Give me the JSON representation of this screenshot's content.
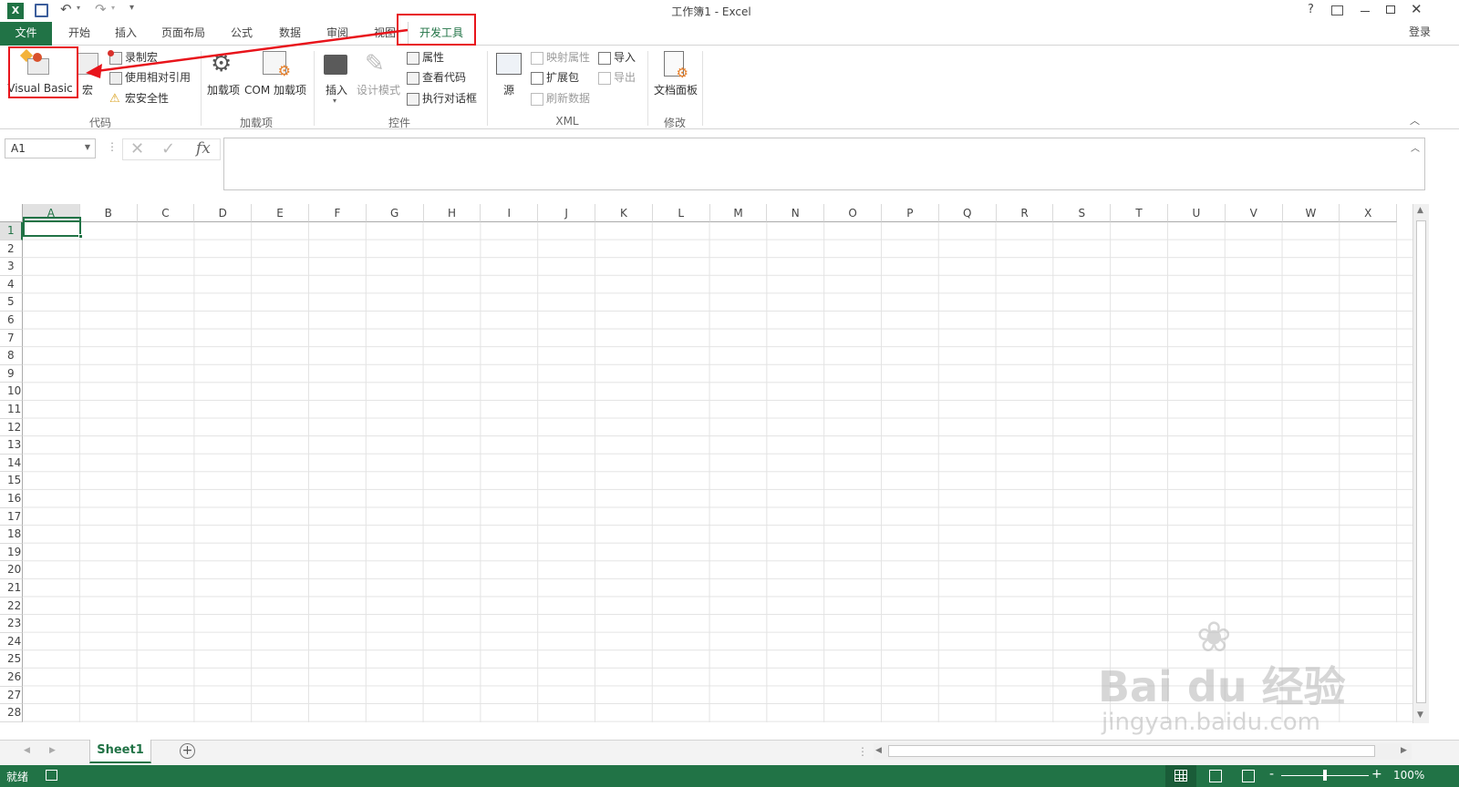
{
  "window": {
    "title": "工作簿1 - Excel",
    "help": "?",
    "signin": "登录"
  },
  "tabs": [
    {
      "label": "文件"
    },
    {
      "label": "开始"
    },
    {
      "label": "插入"
    },
    {
      "label": "页面布局"
    },
    {
      "label": "公式"
    },
    {
      "label": "数据"
    },
    {
      "label": "审阅"
    },
    {
      "label": "视图"
    },
    {
      "label": "开发工具"
    }
  ],
  "ribbon": {
    "code": {
      "label": "代码",
      "visual_basic": "Visual Basic",
      "macro": "宏",
      "record_macro": "录制宏",
      "relative_ref": "使用相对引用",
      "macro_security": "宏安全性"
    },
    "addins": {
      "label": "加载项",
      "addins": "加载项",
      "com_addins": "COM 加载项"
    },
    "controls": {
      "label": "控件",
      "insert": "插入",
      "design_mode": "设计模式",
      "properties": "属性",
      "view_code": "查看代码",
      "run_dialog": "执行对话框"
    },
    "xml": {
      "label": "XML",
      "source": "源",
      "map_props": "映射属性",
      "expansion": "扩展包",
      "refresh": "刷新数据",
      "import": "导入",
      "export": "导出"
    },
    "modify": {
      "label": "修改",
      "doc_panel": "文档面板"
    }
  },
  "formula": {
    "namebox": "A1",
    "fx": "fx",
    "value": ""
  },
  "grid": {
    "columns": [
      "A",
      "B",
      "C",
      "D",
      "E",
      "F",
      "G",
      "H",
      "I",
      "J",
      "K",
      "L",
      "M",
      "N",
      "O",
      "P",
      "Q",
      "R",
      "S",
      "T",
      "U",
      "V",
      "W",
      "X"
    ],
    "rows": [
      "1",
      "2",
      "3",
      "4",
      "5",
      "6",
      "7",
      "8",
      "9",
      "10",
      "11",
      "12",
      "13",
      "14",
      "15",
      "16",
      "17",
      "18",
      "19",
      "20",
      "21",
      "22",
      "23",
      "24",
      "25",
      "26",
      "27",
      "28"
    ],
    "selected": "A1"
  },
  "sheets": [
    {
      "name": "Sheet1"
    }
  ],
  "status": {
    "ready": "就绪",
    "zoom": "100%",
    "zoom_minus": "-",
    "zoom_plus": "+"
  },
  "watermark": {
    "brand": "Bai du 经验",
    "url": "jingyan.baidu.com"
  },
  "colors": {
    "excel_green": "#217346",
    "highlight_red": "#e8141b",
    "active_tab_text": "#217346"
  }
}
